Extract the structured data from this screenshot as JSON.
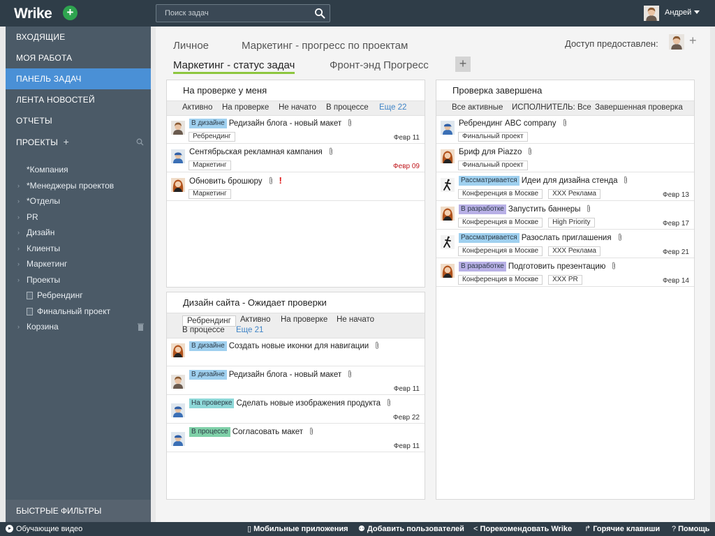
{
  "topbar": {
    "logo": "Wrike",
    "search_placeholder": "Поиск задач",
    "user_name": "Андрей"
  },
  "sidebar": {
    "nav": [
      "ВХОДЯЩИЕ",
      "МОЯ РАБОТА",
      "ПАНЕЛЬ ЗАДАЧ",
      "ЛЕНТА НОВОСТЕЙ",
      "ОТЧЕТЫ"
    ],
    "projects_label": "ПРОЕКТЫ",
    "tree": [
      "*Компания",
      "*Менеджеры проектов",
      "*Отделы",
      "PR",
      "Дизайн",
      "Клиенты",
      "Маркетинг",
      "Проекты",
      "Ребрендинг",
      "Финальный проект",
      "Корзина"
    ],
    "quick_filters": "БЫСТРЫЕ ФИЛЬТРЫ"
  },
  "tabs": {
    "row1": [
      "Личное",
      "Маркетинг - прогресс по проектам"
    ],
    "row2": [
      "Маркетинг - статус задач",
      "Фронт-энд Прогресс"
    ],
    "access_label": "Доступ предоставлен:"
  },
  "panels": {
    "review": {
      "title": "На проверке у меня",
      "filters": [
        "Активно",
        "На проверке",
        "Не начато",
        "В процессе",
        "Еще 22"
      ],
      "tasks": [
        {
          "status": "В дизайне",
          "title": "Редизайн блога - новый макет",
          "tags": [
            "Ребрендинг"
          ],
          "date": "Февр 11"
        },
        {
          "title": "Сентябрьская рекламная кампания",
          "tags": [
            "Маркетинг"
          ],
          "date": "Февр 09"
        },
        {
          "title": "Обновить брошюру",
          "tags": [
            "Маркетинг"
          ]
        }
      ]
    },
    "design": {
      "title": "Дизайн сайта - Ожидает проверки",
      "filters": [
        "Ребрендинг",
        "Активно",
        "На проверке",
        "Не начато",
        "В процессе",
        "Еще 21"
      ],
      "tasks": [
        {
          "status": "В дизайне",
          "title": "Создать новые иконки для навигации"
        },
        {
          "status": "В дизайне",
          "title": "Редизайн блога - новый макет",
          "date": "Февр 11"
        },
        {
          "status": "На проверке",
          "title": "Сделать новые изображения продукта",
          "date": "Февр 22"
        },
        {
          "status": "В процессе",
          "title": "Согласовать макет",
          "date": "Февр 11"
        }
      ]
    },
    "done": {
      "title": "Проверка завершена",
      "filters": [
        "Все активные",
        "ИСПОЛНИТЕЛЬ: Все",
        "Завершенная проверка"
      ],
      "tasks": [
        {
          "title": "Ребрендинг ABC company",
          "tags": [
            "Финальный проект"
          ]
        },
        {
          "title": "Бриф для Piazzo",
          "tags": [
            "Финальный проект"
          ]
        },
        {
          "status": "Рассматривается",
          "title": "Идеи для дизайна стенда",
          "tags": [
            "Конференция в Москве",
            "XXX Реклама"
          ],
          "date": "Февр 13"
        },
        {
          "status": "В разработке",
          "title": "Запустить баннеры",
          "tags": [
            "Конференция в Москве",
            "High Priority"
          ],
          "date": "Февр 17"
        },
        {
          "status": "Рассматривается",
          "title": "Разослать приглашения",
          "tags": [
            "Конференция в Москве",
            "XXX Реклама"
          ],
          "date": "Февр 21"
        },
        {
          "status": "В разработке",
          "title": "Подготовить презентацию",
          "tags": [
            "Конференция в Москве",
            "XXX PR"
          ],
          "date": "Февр 14"
        }
      ]
    }
  },
  "bottombar": {
    "tutorial": "Обучающие видео",
    "links": [
      "Мобильные приложения",
      "Добавить пользователей",
      "Порекомендовать Wrike",
      "Горячие клавиши",
      "Помощь"
    ]
  },
  "colors": {
    "topbar": "#2f3d48",
    "sidebar": "#4b5a67",
    "active_nav": "#4a90d6",
    "tab_underline": "#8dc63f",
    "link": "#3e83c6",
    "overdue": "#c0161b"
  }
}
